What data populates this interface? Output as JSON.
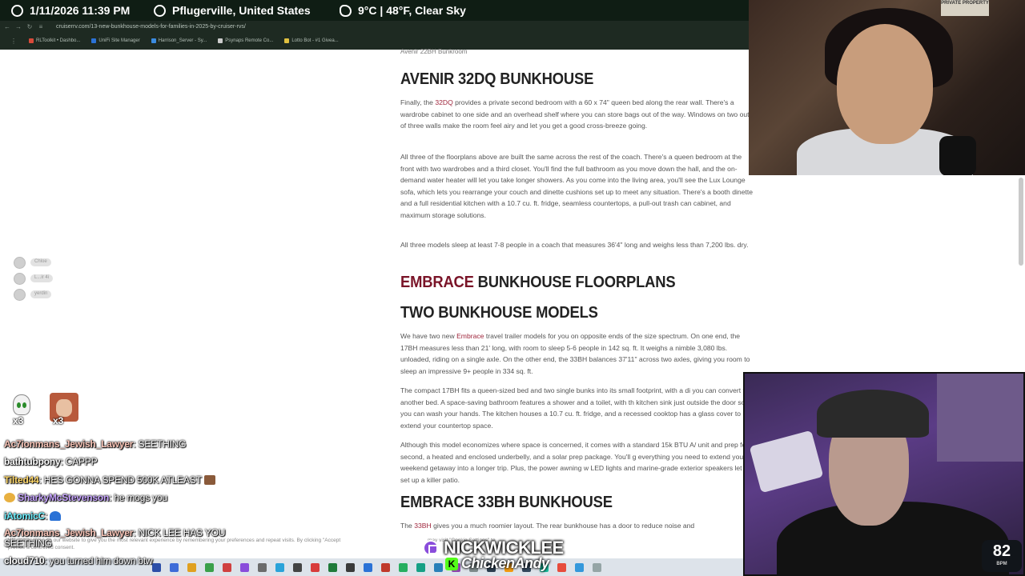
{
  "infobar": {
    "datetime": "1/11/2026 11:39 PM",
    "location": "Pflugerville, United States",
    "weather": "9°C | 48°F, Clear Sky"
  },
  "browser": {
    "url": "cruiserrv.com/13-new-bunkhouse-models-for-families-in-2025-by-cruiser-rvs/",
    "bookmarks": [
      {
        "label": "RLToolkit • Dashbo...",
        "color": "#d94a3a"
      },
      {
        "label": "UniFi Site Manager",
        "color": "#2b72d6"
      },
      {
        "label": "Harrison_Server - Sy...",
        "color": "#3b8be0"
      },
      {
        "label": "Psynaps Remote Co...",
        "color": "#cccccc"
      },
      {
        "label": "Lotto Bot - #1 Givea...",
        "color": "#e0c040"
      }
    ]
  },
  "sidebar_users": [
    "Chloe",
    "L...ir 4i",
    "yerdin"
  ],
  "article": {
    "caption": "Avenir 22BH Bunkroom",
    "h_avenir32": "AVENIR 32DQ BUNKHOUSE",
    "p1_a": "Finally, the ",
    "p1_link": "32DQ",
    "p1_b": " provides a private second bedroom with a 60 x 74\" queen bed along the rear wall. There's a wardrobe cabinet to one side and an overhead shelf where you can store bags out of the way. Windows on two out of three walls make the room feel airy and let you get a good cross-breeze going.",
    "p2": "All three of the floorplans above are built the same across the rest of the coach. There's a queen bedroom at the front with two wardrobes and a third closet. You'll find the full bathroom as you move down the hall, and the on-demand water heater will let you take longer showers. As you come into the living area, you'll see the Lux Lounge sofa, which lets you rearrange your couch and dinette cushions set up to meet any situation. There's a booth dinette and a full residential kitchen with a 10.7 cu. ft. fridge, seamless countertops, a pull-out trash can cabinet, and maximum storage solutions.",
    "p3": "All three models sleep at least 7-8 people in a coach that measures 36'4\" long and weighs less than 7,200 lbs. dry.",
    "h_embrace_accent": "EMBRACE",
    "h_embrace_rest": " BUNKHOUSE FLOORPLANS",
    "h_two": "TWO BUNKHOUSE MODELS",
    "p4_a": "We have two new ",
    "p4_link": "Embrace",
    "p4_b": " travel trailer models for you on opposite ends of the size spectrum. On one end, the 17BH measures less than 21' long, with room to sleep 5-6 people in 142 sq. ft. It weighs a nimble 3,080 lbs. unloaded, riding on a single axle. On the other end, the 33BH balances 37'11\" across two axles, giving you room to sleep an impressive 9+ people in 334 sq. ft.",
    "p5": "The compact 17BH fits a queen-sized bed and two single bunks into its small footprint, with a di you can convert to another bed. A space-saving bathroom features a shower and a toilet, with th kitchen sink just outside the door so you can wash your hands. The kitchen houses a 10.7 cu. ft. fridge, and a recessed cooktop has a glass cover to extend your countertop space.",
    "p6": "Although this model economizes where space is concerned, it comes with a standard 15k BTU A/ unit and prep for a second, a heated and enclosed underbelly, and a solar prep package. You'll g everything you need to extend your weekend getaway into a longer trip. Plus, the power awning w LED lights and marine-grade exterior speakers let you set up a killer patio.",
    "h_33bh": "EMBRACE 33BH BUNKHOUSE",
    "p7_a": "The ",
    "p7_link": "33BH",
    "p7_b": " gives you a much roomier layout. The rear bunkhouse has a door to reduce noise and"
  },
  "cam1_sign": "PRIVATE PROPERTY",
  "bpm": {
    "value": "82",
    "label": "BPM"
  },
  "emotes": [
    {
      "name": "skull-emote",
      "count": "x3"
    },
    {
      "name": "face-emote",
      "count": "x3"
    }
  ],
  "chat": [
    {
      "user": "Ac7ionmans_Jewish_Lawyer",
      "color": "#f9c5b8",
      "text": " SEETHING",
      "icon": ""
    },
    {
      "user": "bathtubpony",
      "color": "#ffffff",
      "text": " CAPPP",
      "icon": ""
    },
    {
      "user": "Tilted44",
      "color": "#ffd86b",
      "text": " HES GONNA SPEND 500K ATLEAST",
      "icon": "trail"
    },
    {
      "user": "SharkyMcStevenson",
      "color": "#c8a6ff",
      "text": " he mogs you",
      "icon": "lead"
    },
    {
      "user": "iAtomicC",
      "color": "#6ef0ff",
      "text": " ",
      "icon": "cap"
    },
    {
      "user": "Ac7ionmans_Jewish_Lawyer",
      "color": "#f9c5b8",
      "text": " NICK LEE HAS YOU SEETHING",
      "icon": ""
    },
    {
      "user": "cloud710",
      "color": "#ffffff",
      "text": " you turned him down btw",
      "icon": ""
    }
  ],
  "cookie": {
    "line1": "We use cookies on our website to give you the most relevant experience by remembering your preferences and repeat visits. By clicking \"Accept",
    "line1b": "may visit \"Cookie Settings\" to",
    "line2": "provide a controlled consent."
  },
  "collab": {
    "name1": "NICKWICKLEE",
    "name2": "ChickenAndy"
  },
  "taskbar_colors": [
    "#2b4ea8",
    "#3d6bd8",
    "#e0a020",
    "#3aa04a",
    "#d04040",
    "#8a4ddb",
    "#6b6b6b",
    "#2aa3d9",
    "#444444",
    "#d83b3b",
    "#1f7a3a",
    "#3a3a3a",
    "#2b72d6",
    "#c0392b",
    "#27ae60",
    "#16a085",
    "#2980b9",
    "#8e44ad",
    "#7f8c8d",
    "#2c3e50",
    "#f39c12",
    "#34495e",
    "#1abc9c",
    "#e74c3c",
    "#3498db",
    "#95a5a6"
  ]
}
